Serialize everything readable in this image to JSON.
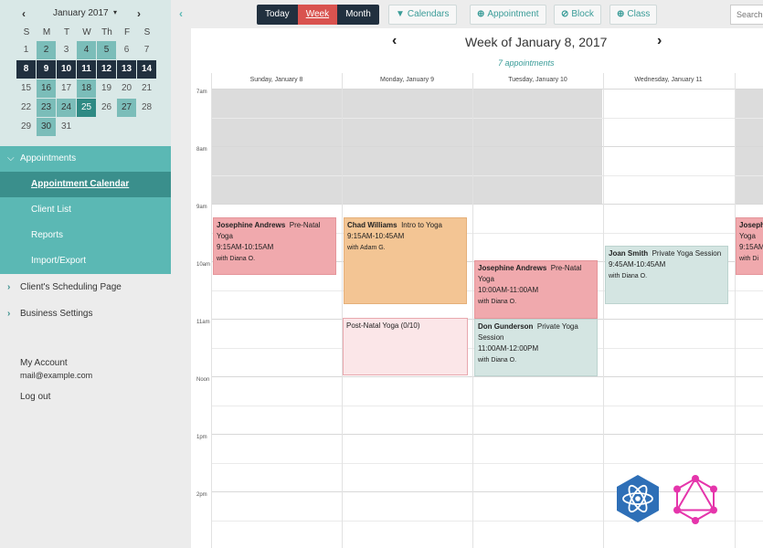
{
  "mini_calendar": {
    "title": "January 2017",
    "prev_glyph": "‹",
    "next_glyph": "›",
    "caret_glyph": "▾",
    "dows": [
      "S",
      "M",
      "T",
      "W",
      "Th",
      "F",
      "S"
    ],
    "days": [
      {
        "d": "1",
        "s": "n"
      },
      {
        "d": "2",
        "s": "hl"
      },
      {
        "d": "3",
        "s": "n"
      },
      {
        "d": "4",
        "s": "hl"
      },
      {
        "d": "5",
        "s": "hl"
      },
      {
        "d": "6",
        "s": "n"
      },
      {
        "d": "7",
        "s": "n"
      },
      {
        "d": "8",
        "s": "dark"
      },
      {
        "d": "9",
        "s": "dark"
      },
      {
        "d": "10",
        "s": "dark"
      },
      {
        "d": "11",
        "s": "dark"
      },
      {
        "d": "12",
        "s": "dark"
      },
      {
        "d": "13",
        "s": "dark"
      },
      {
        "d": "14",
        "s": "dark"
      },
      {
        "d": "15",
        "s": "n"
      },
      {
        "d": "16",
        "s": "hl"
      },
      {
        "d": "17",
        "s": "n"
      },
      {
        "d": "18",
        "s": "hl"
      },
      {
        "d": "19",
        "s": "n"
      },
      {
        "d": "20",
        "s": "n"
      },
      {
        "d": "21",
        "s": "n"
      },
      {
        "d": "22",
        "s": "n"
      },
      {
        "d": "23",
        "s": "hl"
      },
      {
        "d": "24",
        "s": "hl"
      },
      {
        "d": "25",
        "s": "today"
      },
      {
        "d": "26",
        "s": "n"
      },
      {
        "d": "27",
        "s": "hl"
      },
      {
        "d": "28",
        "s": "n"
      },
      {
        "d": "29",
        "s": "n"
      },
      {
        "d": "30",
        "s": "hl"
      },
      {
        "d": "31",
        "s": "n"
      }
    ]
  },
  "nav": {
    "appointments": "Appointments",
    "expand_glyph": "⌵",
    "arrow_glyph": "›",
    "appointment_calendar": "Appointment Calendar",
    "client_list": "Client List",
    "reports": "Reports",
    "import_export": "Import/Export",
    "scheduling_page": "Client's Scheduling Page",
    "business_settings": "Business Settings"
  },
  "account": {
    "label": "My Account",
    "email": "mail@example.com",
    "logout": "Log out"
  },
  "collapse_glyph": "‹",
  "toolbar": {
    "today": "Today",
    "week": "Week",
    "month": "Month",
    "calendars": "Calendars",
    "appointment": "Appointment",
    "block": "Block",
    "class": "Class",
    "filter_glyph": "▼",
    "plus_glyph": "⊕",
    "block_glyph": "⊘",
    "search_placeholder": "Search"
  },
  "main": {
    "week_title": "Week of January 8, 2017",
    "appt_count": "7 appointments",
    "prev_glyph": "‹",
    "next_glyph": "›",
    "columns": [
      "Sunday, January 8",
      "Monday, January 9",
      "Tuesday, January 10",
      "Wednesday, January 11"
    ],
    "time_labels": [
      "7am",
      "8am",
      "9am",
      "10am",
      "11am",
      "Noon",
      "1pm",
      "2pm"
    ]
  },
  "appointments": [
    {
      "name": "Josephine Andrews",
      "title": "Pre-Natal Yoga",
      "time": "9:15AM-10:15AM",
      "with": "with Diana O.",
      "color": "pink"
    },
    {
      "name": "Chad Williams",
      "title": "Intro to Yoga",
      "time": "9:15AM-10:45AM",
      "with": "with Adam G.",
      "color": "orange"
    },
    {
      "name": "",
      "title": "Post-Natal Yoga (0/10)",
      "time": "",
      "with": "",
      "color": "lightpink"
    },
    {
      "name": "Josephine Andrews",
      "title": "Pre-Natal Yoga",
      "time": "10:00AM-11:00AM",
      "with": "with Diana O.",
      "color": "pink"
    },
    {
      "name": "Don Gunderson",
      "title": "Private Yoga Session",
      "time": "11:00AM-12:00PM",
      "with": "with Diana O.",
      "color": "teal"
    },
    {
      "name": "Joan Smith",
      "title": "Private Yoga Session",
      "time": "9:45AM-10:45AM",
      "with": "with Diana O.",
      "color": "teal"
    },
    {
      "name": "Joseph",
      "title": "Yoga",
      "time": "9:15AM",
      "with": "with Di",
      "color": "pink"
    }
  ],
  "colors": {
    "teal": "#5bb8b4",
    "navy": "#21303f",
    "red": "#d9534f",
    "react_blue": "#2e6fb7",
    "graphql_pink": "#e535ab"
  },
  "icons": {
    "react": "react-logo-icon",
    "graphql": "graphql-logo-icon"
  }
}
